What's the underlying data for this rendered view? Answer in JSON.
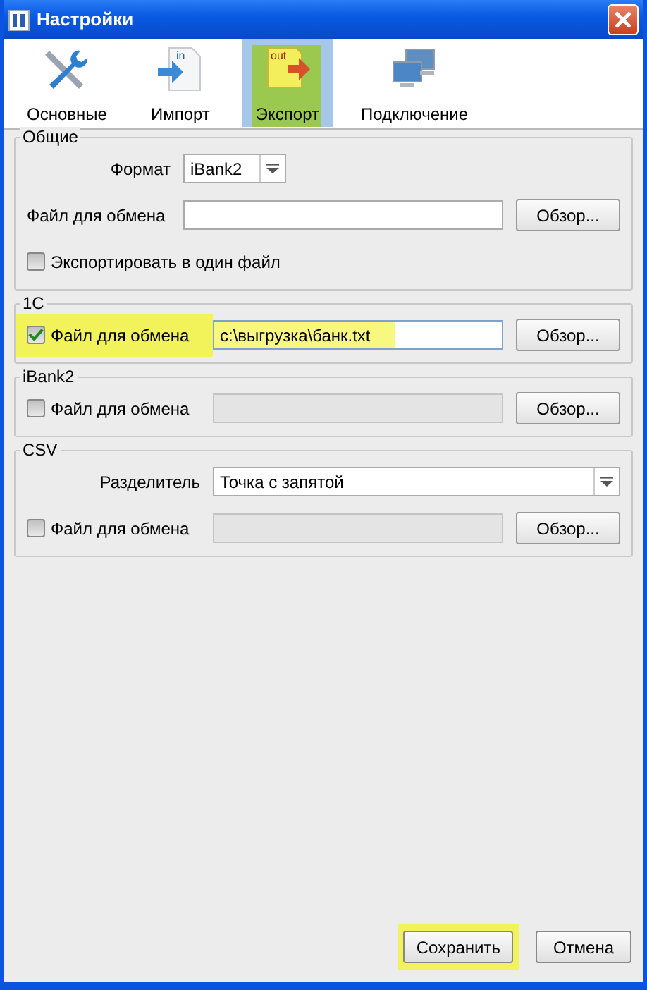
{
  "window": {
    "title": "Настройки"
  },
  "tabs": [
    {
      "label": "Основные",
      "selected": false,
      "highlighted": false
    },
    {
      "label": "Импорт",
      "icon_text": "in",
      "selected": false,
      "highlighted": false
    },
    {
      "label": "Экспорт",
      "icon_text": "out",
      "selected": true,
      "highlighted": true
    },
    {
      "label": "Подключение",
      "selected": false,
      "highlighted": false
    }
  ],
  "sections": [
    {
      "title": "Общие",
      "rows": [
        {
          "kind": "select",
          "label": "Формат",
          "value": "iBank2"
        },
        {
          "kind": "file",
          "label": "Файл для обмена",
          "value": "",
          "button": "Обзор..."
        },
        {
          "kind": "checkbox",
          "label": "Экспортировать в один файл",
          "checked": false
        }
      ]
    },
    {
      "title": "1С",
      "rows": [
        {
          "kind": "checkfile",
          "label": "Файл для обмена",
          "checked": true,
          "value": "c:\\выгрузка\\банк.txt",
          "button": "Обзор...",
          "highlighted": true
        }
      ]
    },
    {
      "title": "iBank2",
      "rows": [
        {
          "kind": "checkfile",
          "label": "Файл для обмена",
          "checked": false,
          "value": "",
          "button": "Обзор...",
          "highlighted": false
        }
      ]
    },
    {
      "title": "CSV",
      "rows": [
        {
          "kind": "select",
          "label": "Разделитель",
          "value": "Точка с запятой"
        },
        {
          "kind": "checkfile",
          "label": "Файл для обмена",
          "checked": false,
          "value": "",
          "button": "Обзор...",
          "highlighted": false
        }
      ]
    }
  ],
  "buttons": [
    {
      "label": "Сохранить",
      "highlighted": true
    },
    {
      "label": "Отмена",
      "highlighted": false
    }
  ]
}
